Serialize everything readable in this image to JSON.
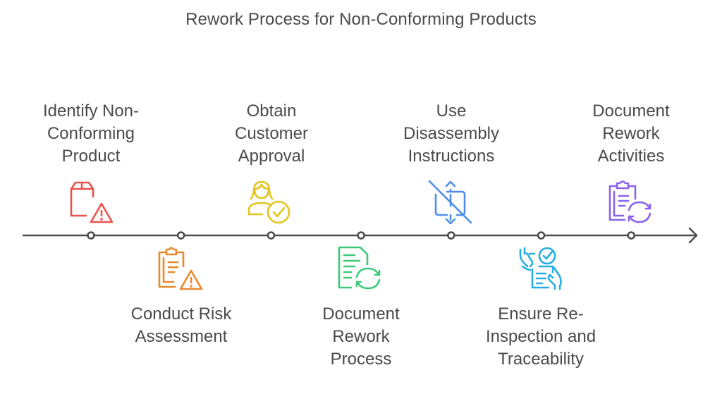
{
  "title": "Rework Process for Non-Conforming Products",
  "colors": {
    "line": "#4a4a4a",
    "text": "#4a4a4a"
  },
  "steps": [
    {
      "label": "Identify Non-\nConforming\nProduct",
      "position": "top",
      "icon": "package-warning-icon",
      "color": "#e8524f"
    },
    {
      "label": "Conduct Risk\nAssessment",
      "position": "bottom",
      "icon": "clipboard-warning-icon",
      "color": "#e8892f"
    },
    {
      "label": "Obtain\nCustomer\nApproval",
      "position": "top",
      "icon": "user-check-icon",
      "color": "#e2c51d"
    },
    {
      "label": "Document\nRework\nProcess",
      "position": "bottom",
      "icon": "document-refresh-icon",
      "color": "#3ec97a"
    },
    {
      "label": "Use\nDisassembly\nInstructions",
      "position": "top",
      "icon": "disassembly-off-icon",
      "color": "#4f8ee8"
    },
    {
      "label": "Ensure Re-\nInspection and\nTraceability",
      "position": "bottom",
      "icon": "hands-checklist-icon",
      "color": "#27aee0"
    },
    {
      "label": "Document\nRework\nActivities",
      "position": "top",
      "icon": "clipboard-refresh-icon",
      "color": "#8a63e8"
    }
  ]
}
